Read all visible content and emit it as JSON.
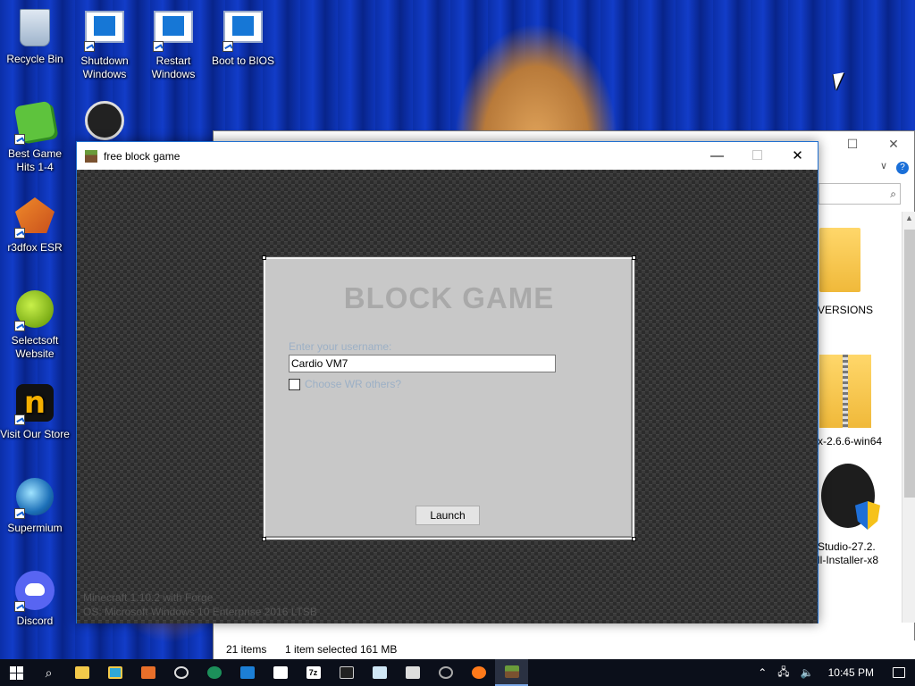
{
  "desktop": {
    "icons": [
      {
        "label": "Recycle Bin"
      },
      {
        "label": "Shutdown Windows"
      },
      {
        "label": "Restart Windows"
      },
      {
        "label": "Boot to BIOS"
      },
      {
        "label": "Best Game Hits 1-4"
      },
      {
        "label": "r3dfox ESR"
      },
      {
        "label": "Selectsoft Website"
      },
      {
        "label": "Visit Our Store"
      },
      {
        "label": "Supermium"
      },
      {
        "label": "Discord"
      }
    ]
  },
  "explorer": {
    "items": [
      "VERSIONS",
      "x-2.6.6-win64",
      "Studio-27.2.",
      "ll-Installer-x8"
    ],
    "status": {
      "count": "21 items",
      "selected": "1 item selected",
      "size": "161 MB"
    },
    "controls": {
      "minimize": "—",
      "maximize": "☐",
      "close": "✕"
    }
  },
  "game_window": {
    "title": "free block game",
    "controls": {
      "minimize": "—",
      "maximize": "☐",
      "close": "✕"
    },
    "dialog": {
      "heading": "BLOCK GAME",
      "username_label": "Enter your username:",
      "username_value": "Cardio VM7",
      "checkbox_label": "Choose WR others?",
      "launch_label": "Launch"
    },
    "footer": {
      "line1": "Minecraft 1.10.2 with Forge",
      "line2": "OS: Microsoft Windows 10 Enterprise 2016 LTSB"
    }
  },
  "taskbar": {
    "clock": "10:45 PM",
    "accent": "#7aa7e6"
  }
}
